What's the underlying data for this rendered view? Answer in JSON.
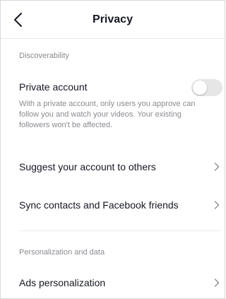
{
  "header": {
    "title": "Privacy",
    "back_icon": "chevron-left-icon"
  },
  "sections": {
    "discoverability": {
      "label": "Discoverability",
      "private_account": {
        "label": "Private account",
        "enabled": false,
        "description": "With a private account, only users you approve can follow you and watch your videos. Your existing followers won't be affected."
      },
      "suggest": {
        "label": "Suggest your account to others"
      },
      "sync": {
        "label": "Sync contacts and Facebook friends"
      }
    },
    "personalization": {
      "label": "Personalization and data",
      "ads": {
        "label": "Ads personalization"
      }
    }
  },
  "colors": {
    "text": "#161823",
    "secondary_text": "#8a8b91",
    "toggle_off": "#e6e6e7",
    "divider": "#ececec"
  }
}
